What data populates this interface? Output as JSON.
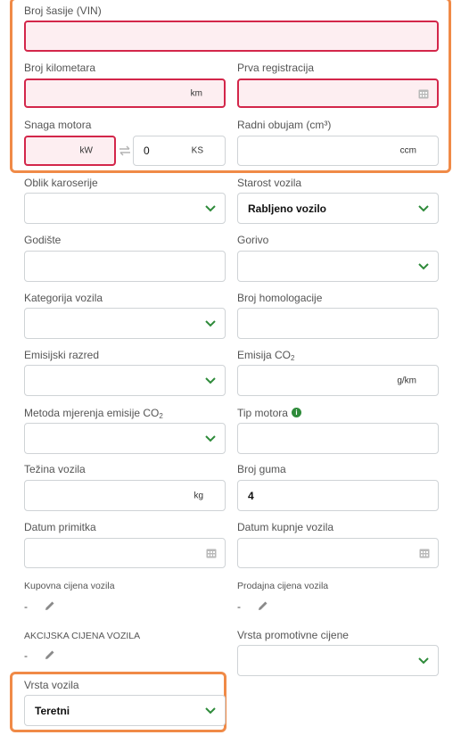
{
  "form": {
    "vin": {
      "label": "Broj šasije (VIN)",
      "value": ""
    },
    "km": {
      "label": "Broj kilometara",
      "unit": "km",
      "value": ""
    },
    "first_reg": {
      "label": "Prva registracija",
      "value": ""
    },
    "power": {
      "label": "Snaga motora",
      "kw_unit": "kW",
      "ks_value": "0",
      "ks_unit": "KS"
    },
    "displacement": {
      "label": "Radni obujam (cm³)",
      "unit": "ccm"
    },
    "body_shape": {
      "label": "Oblik karoserije",
      "value": ""
    },
    "vehicle_age": {
      "label": "Starost vozila",
      "value": "Rabljeno vozilo"
    },
    "year": {
      "label": "Godište",
      "value": ""
    },
    "fuel": {
      "label": "Gorivo",
      "value": ""
    },
    "category": {
      "label": "Kategorija vozila",
      "value": ""
    },
    "homologation": {
      "label": "Broj homologacije",
      "value": ""
    },
    "emission_class": {
      "label": "Emisijski razred",
      "value": ""
    },
    "co2_emission": {
      "label_prefix": "Emisija CO",
      "label_sub": "2",
      "unit": "g/km"
    },
    "co2_method": {
      "label_prefix": "Metoda mjerenja emisije CO",
      "label_sub": "2",
      "value": ""
    },
    "engine_type": {
      "label": "Tip motora",
      "info_glyph": "i"
    },
    "weight": {
      "label": "Težina vozila",
      "unit": "kg"
    },
    "tyres": {
      "label": "Broj guma",
      "value": "4"
    },
    "receipt_date": {
      "label": "Datum primitka"
    },
    "purchase_date": {
      "label": "Datum kupnje vozila"
    },
    "purchase_price": {
      "label": "Kupovna cijena vozila",
      "value": "-"
    },
    "sale_price": {
      "label": "Prodajna cijena vozila",
      "value": "-"
    },
    "promo_price": {
      "label": "AKCIJSKA CIJENA VOZILA",
      "value": "-"
    },
    "promo_type": {
      "label": "Vrsta promotivne cijene",
      "value": ""
    },
    "vehicle_type": {
      "label": "Vrsta vozila",
      "value": "Teretni"
    }
  },
  "colors": {
    "error_border": "#d3264a",
    "error_bg": "#fdeef1",
    "highlight": "#f08a47",
    "chevron": "#2e8b3a"
  },
  "icons": [
    "chevron-down-icon",
    "calendar-icon",
    "pencil-icon",
    "swap-icon",
    "info-icon"
  ]
}
